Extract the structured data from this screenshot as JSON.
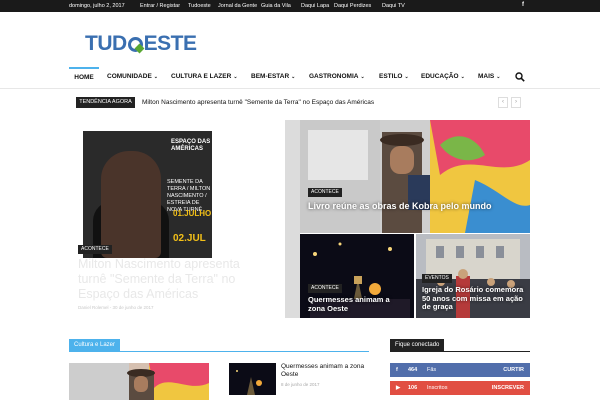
{
  "topbar": {
    "date": "domingo, julho 2, 2017",
    "links": [
      "Entrar / Registar",
      "Tudoeste",
      "Jornal da Gente",
      "Guia da Vila",
      "Daqui Lapa",
      "Daqui Perdizes",
      "Daqui TV"
    ],
    "facebook": "f"
  },
  "logo": {
    "part1": "TUD",
    "part2": "ESTE"
  },
  "nav": {
    "items": [
      {
        "label": "HOME",
        "caret": ""
      },
      {
        "label": "COMUNIDADE",
        "caret": "⌄"
      },
      {
        "label": "CULTURA E LAZER",
        "caret": "⌄"
      },
      {
        "label": "BEM-ESTAR",
        "caret": "⌄"
      },
      {
        "label": "GASTRONOMIA",
        "caret": "⌄"
      },
      {
        "label": "ESTILO",
        "caret": "⌄"
      },
      {
        "label": "EDUCAÇÃO",
        "caret": "⌄"
      },
      {
        "label": "MAIS",
        "caret": "⌄"
      }
    ]
  },
  "trending": {
    "label": "TENDÊNCIA AGORA",
    "text": "Milton Nascimento apresenta turnê \"Semente da Terra\" no Espaço das Américas",
    "prev": "‹",
    "next": "›"
  },
  "featured": {
    "main": {
      "badge": "ACONTECE",
      "title": "Milton Nascimento apresenta turnê \"Semente da Terra\" no Espaço das Américas",
      "meta": "Daniel Rolemel - 30 de junho de 2017",
      "poster_brand": "ESPAÇO DAS AMÉRICAS",
      "poster_name": "SEMENTE DA TERRA / MILTON NASCIMENTO / ESTREIA DE NOVA TURNÊ",
      "poster_date1": "01.JULHO",
      "poster_date2": "02.JUL"
    },
    "tiles": [
      {
        "badge": "ACONTECE",
        "title": "Livro reúne as obras de Kobra pelo mundo"
      },
      {
        "badge": "ACONTECE",
        "title": "Quermesses animam a zona Oeste"
      },
      {
        "badge": "EVENTOS",
        "title": "Igreja do Rosário comemora 50 anos com missa em ação de graça"
      }
    ]
  },
  "section": {
    "label": "Cultura e Lazer",
    "list": [
      {
        "title": "Quermesses animam a zona Oeste",
        "date": "8 de junho de 2017"
      }
    ]
  },
  "sidebar": {
    "label": "Fique conectado",
    "social": [
      {
        "icon": "f",
        "count": "464",
        "label": "Fãs",
        "action": "CURTIR",
        "color": "#516eab"
      },
      {
        "icon": "▶",
        "count": "106",
        "label": "Inscritos",
        "action": "INSCREVER",
        "color": "#e14e42"
      }
    ]
  },
  "colors": {
    "accent": "#4db2ec",
    "gold": "#dca51e",
    "dark": "#222222"
  }
}
